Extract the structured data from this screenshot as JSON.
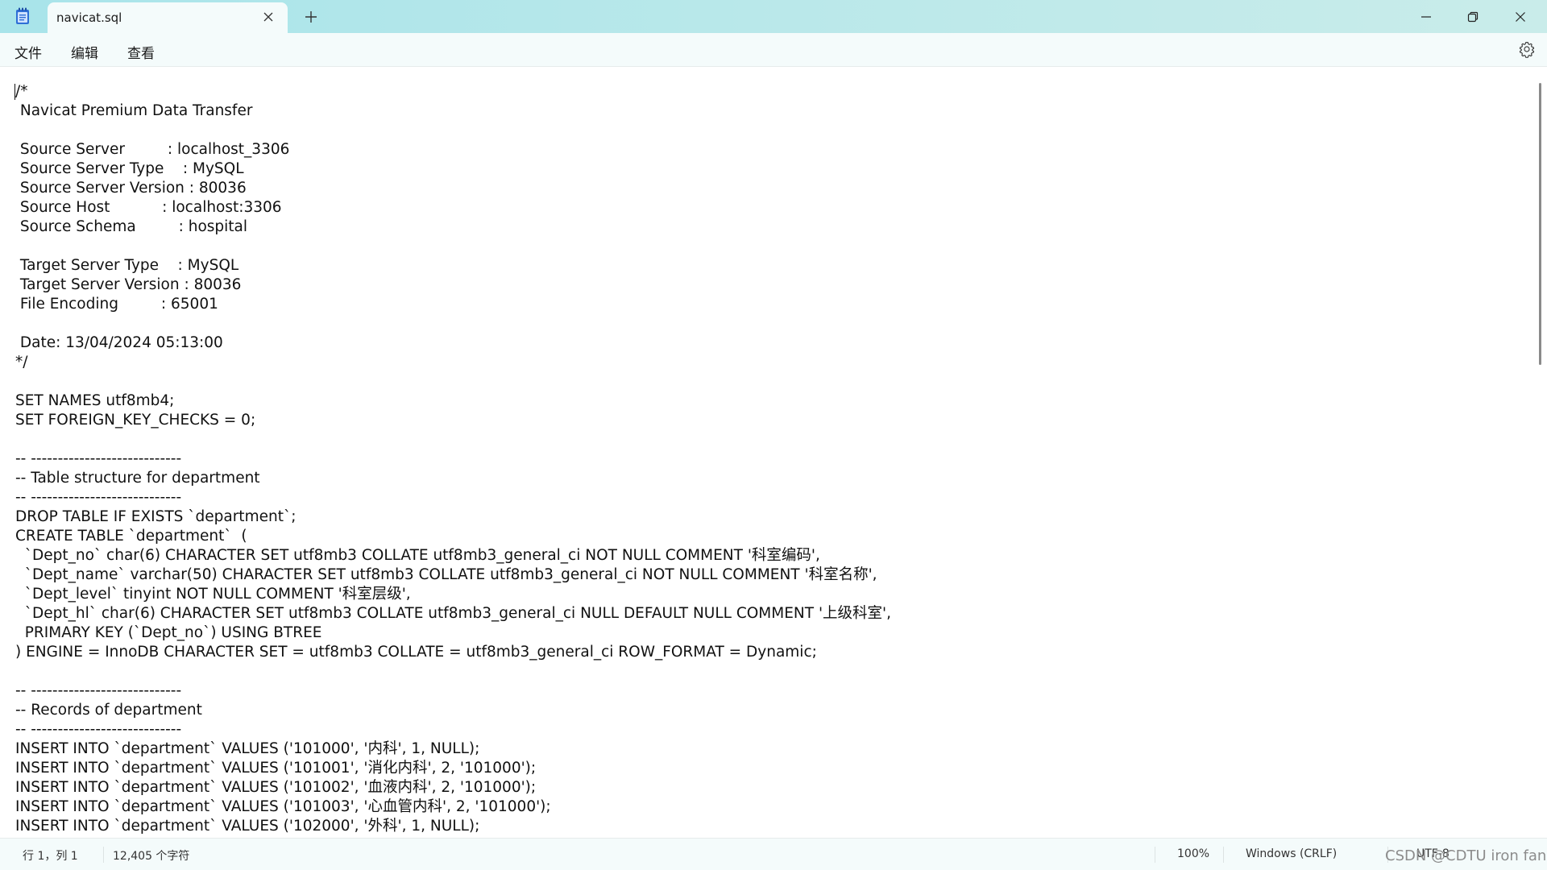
{
  "window": {
    "tab_title": "navicat.sql"
  },
  "menu": {
    "file": "文件",
    "edit": "编辑",
    "view": "查看"
  },
  "icons": {
    "app": "notepad-icon",
    "tab_close": "close-icon",
    "new_tab": "plus-icon",
    "minimize": "minimize-icon",
    "maximize": "restore-icon",
    "close": "close-icon",
    "settings": "gear-icon"
  },
  "editor": {
    "lines": [
      "/*",
      " Navicat Premium Data Transfer",
      "",
      " Source Server         : localhost_3306",
      " Source Server Type    : MySQL",
      " Source Server Version : 80036",
      " Source Host           : localhost:3306",
      " Source Schema         : hospital",
      "",
      " Target Server Type    : MySQL",
      " Target Server Version : 80036",
      " File Encoding         : 65001",
      "",
      " Date: 13/04/2024 05:13:00",
      "*/",
      "",
      "SET NAMES utf8mb4;",
      "SET FOREIGN_KEY_CHECKS = 0;",
      "",
      "-- ----------------------------",
      "-- Table structure for department",
      "-- ----------------------------",
      "DROP TABLE IF EXISTS `department`;",
      "CREATE TABLE `department`  (",
      "  `Dept_no` char(6) CHARACTER SET utf8mb3 COLLATE utf8mb3_general_ci NOT NULL COMMENT '科室编码',",
      "  `Dept_name` varchar(50) CHARACTER SET utf8mb3 COLLATE utf8mb3_general_ci NOT NULL COMMENT '科室名称',",
      "  `Dept_level` tinyint NOT NULL COMMENT '科室层级',",
      "  `Dept_hl` char(6) CHARACTER SET utf8mb3 COLLATE utf8mb3_general_ci NULL DEFAULT NULL COMMENT '上级科室',",
      "  PRIMARY KEY (`Dept_no`) USING BTREE",
      ") ENGINE = InnoDB CHARACTER SET = utf8mb3 COLLATE = utf8mb3_general_ci ROW_FORMAT = Dynamic;",
      "",
      "-- ----------------------------",
      "-- Records of department",
      "-- ----------------------------",
      "INSERT INTO `department` VALUES ('101000', '内科', 1, NULL);",
      "INSERT INTO `department` VALUES ('101001', '消化内科', 2, '101000');",
      "INSERT INTO `department` VALUES ('101002', '血液内科', 2, '101000');",
      "INSERT INTO `department` VALUES ('101003', '心血管内科', 2, '101000');",
      "INSERT INTO `department` VALUES ('102000', '外科', 1, NULL);"
    ]
  },
  "status": {
    "position": "行 1，列 1",
    "char_count": "12,405 个字符",
    "zoom": "100%",
    "line_ending": "Windows (CRLF)",
    "encoding": "UTF-8"
  },
  "watermark": "CSDN @CDTU iron fan"
}
